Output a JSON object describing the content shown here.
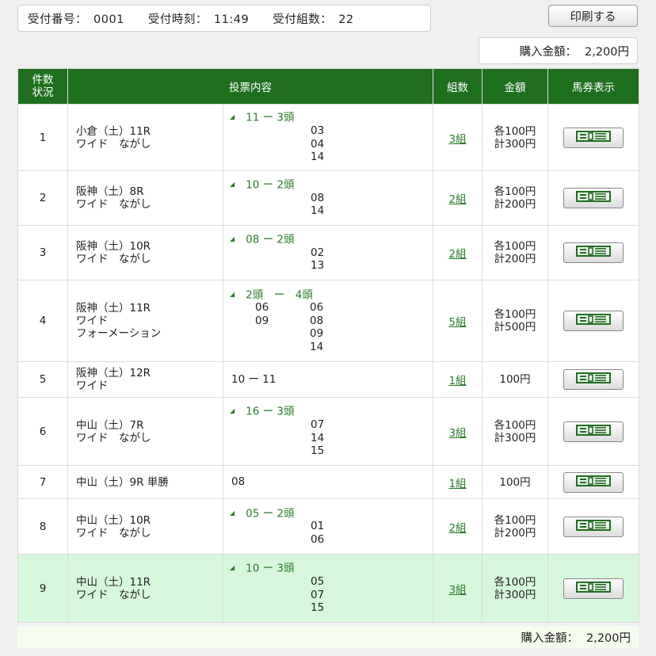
{
  "receipt": {
    "number_label": "受付番号：",
    "number_value": "0001",
    "time_label": "受付時刻：",
    "time_value": "11:49",
    "groups_label": "受付組数：",
    "groups_value": "22"
  },
  "print_button": "印刷する",
  "purchase_total": {
    "label": "購入金額：",
    "value": "2,200円"
  },
  "table": {
    "headers": {
      "no_line1": "件数",
      "no_line2": "状況",
      "content": "投票内容",
      "count": "組数",
      "amount": "金額",
      "ticket": "馬券表示"
    },
    "rows": [
      {
        "no": "1",
        "race": [
          "小倉（土）11R",
          "ワイド　ながし"
        ],
        "head": "11 ー 3頭",
        "cols": [
          [],
          [
            "03",
            "04",
            "14"
          ]
        ],
        "count": "3組",
        "amount": [
          "各100円",
          "計300円"
        ]
      },
      {
        "no": "2",
        "race": [
          "阪神（土）8R",
          "ワイド　ながし"
        ],
        "head": "10 ー 2頭",
        "cols": [
          [],
          [
            "08",
            "14"
          ]
        ],
        "count": "2組",
        "amount": [
          "各100円",
          "計200円"
        ]
      },
      {
        "no": "3",
        "race": [
          "阪神（土）10R",
          "ワイド　ながし"
        ],
        "head": "08 ー 2頭",
        "cols": [
          [],
          [
            "02",
            "13"
          ]
        ],
        "count": "2組",
        "amount": [
          "各100円",
          "計200円"
        ]
      },
      {
        "no": "4",
        "race": [
          "阪神（土）11R",
          "ワイド",
          "フォーメーション"
        ],
        "head": "2頭　ー　4頭",
        "cols": [
          [
            "06",
            "09"
          ],
          [
            "06",
            "08",
            "09",
            "14"
          ]
        ],
        "count": "5組",
        "amount": [
          "各100円",
          "計500円"
        ]
      },
      {
        "no": "5",
        "race": [
          "阪神（土）12R",
          "ワイド"
        ],
        "plain": "10 ー 11",
        "count": "1組",
        "amount": [
          "100円"
        ]
      },
      {
        "no": "6",
        "race": [
          "中山（土）7R",
          "ワイド　ながし"
        ],
        "head": "16 ー 3頭",
        "cols": [
          [],
          [
            "07",
            "14",
            "15"
          ]
        ],
        "count": "3組",
        "amount": [
          "各100円",
          "計300円"
        ]
      },
      {
        "no": "7",
        "race": [
          "中山（土）9R 単勝"
        ],
        "plain": "08",
        "count": "1組",
        "amount": [
          "100円"
        ]
      },
      {
        "no": "8",
        "race": [
          "中山（土）10R",
          "ワイド　ながし"
        ],
        "head": "05 ー 2頭",
        "cols": [
          [],
          [
            "01",
            "06"
          ]
        ],
        "count": "2組",
        "amount": [
          "各100円",
          "計200円"
        ]
      },
      {
        "no": "9",
        "race": [
          "中山（土）11R",
          "ワイド　ながし"
        ],
        "head": "10 ー 3頭",
        "cols": [
          [],
          [
            "05",
            "07",
            "15"
          ]
        ],
        "count": "3組",
        "amount": [
          "各100円",
          "計300円"
        ],
        "highlight": true
      }
    ]
  },
  "footer_total": {
    "label": "購入金額：",
    "value": "2,200円"
  },
  "colors": {
    "header_green": "#1f6f1f",
    "link_green": "#2a7a2a",
    "highlight_row": "#d7f7dc"
  },
  "icons": {
    "ticket": "ticket-icon",
    "triangle": "triangle-marker-icon"
  }
}
